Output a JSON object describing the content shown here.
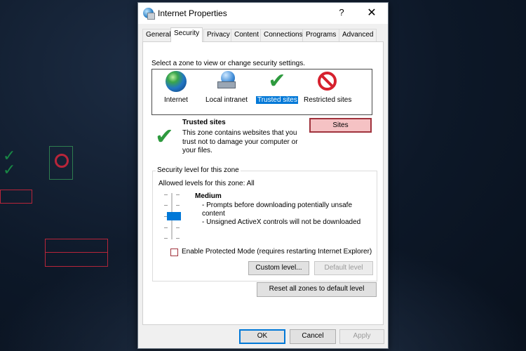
{
  "window": {
    "title": "Internet Properties",
    "help_glyph": "?",
    "close_glyph": "✕"
  },
  "tabs": [
    {
      "label": "General"
    },
    {
      "label": "Security",
      "active": true
    },
    {
      "label": "Privacy"
    },
    {
      "label": "Content"
    },
    {
      "label": "Connections"
    },
    {
      "label": "Programs"
    },
    {
      "label": "Advanced"
    }
  ],
  "security": {
    "zone_prompt": "Select a zone to view or change security settings.",
    "zones": [
      {
        "label": "Internet",
        "icon": "globe-icon"
      },
      {
        "label": "Local intranet",
        "icon": "intranet-icon"
      },
      {
        "label": "Trusted sites",
        "icon": "checkmark-icon",
        "selected": true
      },
      {
        "label": "Restricted sites",
        "icon": "no-entry-icon"
      }
    ],
    "selected_zone": {
      "title": "Trusted sites",
      "description": "This zone contains websites that you trust not to damage your computer or your files.",
      "sites_button": "Sites"
    },
    "level_group": {
      "legend": "Security level for this zone",
      "allowed": "Allowed levels for this zone: All",
      "level": "Medium",
      "bullets": [
        "- Prompts before downloading potentially unsafe content",
        "- Unsigned ActiveX controls will not be downloaded"
      ],
      "protected_mode_label": "Enable Protected Mode (requires restarting Internet Explorer)",
      "protected_mode_checked": false,
      "custom_level_button": "Custom level...",
      "default_level_button": "Default level"
    },
    "reset_button": "Reset all zones to default level"
  },
  "footer": {
    "ok": "OK",
    "cancel": "Cancel",
    "apply": "Apply"
  },
  "colors": {
    "accent": "#0078d7",
    "highlight_border": "#a0333d",
    "highlight_fill": "#f5c2c4",
    "check_green": "#2e9a3e",
    "restricted_red": "#d6212e"
  }
}
